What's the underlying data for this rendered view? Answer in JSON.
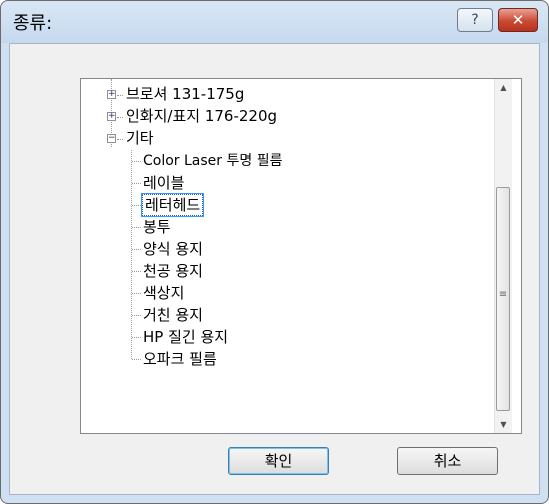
{
  "dialog": {
    "title": "종류:",
    "help_label": "?",
    "close_label": "✕"
  },
  "tree": {
    "collapsed_glyph": "+",
    "expanded_glyph": "−",
    "items": [
      {
        "label": "브로셔 131-175g",
        "state": "collapsed"
      },
      {
        "label": "인화지/표지 176-220g",
        "state": "collapsed"
      },
      {
        "label": "기타",
        "state": "expanded",
        "children": [
          "Color Laser 투명 필름",
          "레이블",
          "레터헤드",
          "봉투",
          "양식 용지",
          "천공 용지",
          "색상지",
          "거친 용지",
          "HP 질긴 용지",
          "오파크 필름"
        ]
      }
    ],
    "selected": "레터헤드"
  },
  "scrollbar": {
    "up_glyph": "▲",
    "down_glyph": "▼",
    "grip_glyph": "≡"
  },
  "buttons": {
    "ok_label": "확인",
    "cancel_label": "취소"
  }
}
